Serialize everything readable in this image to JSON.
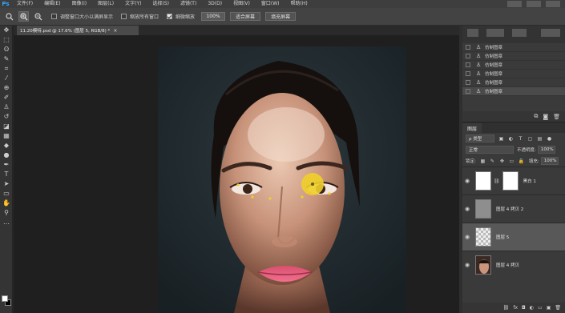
{
  "app": {
    "logo": "Ps"
  },
  "menu": [
    "文件(F)",
    "编辑(E)",
    "图像(I)",
    "图层(L)",
    "文字(Y)",
    "选择(S)",
    "滤镜(T)",
    "3D(D)",
    "视图(V)",
    "窗口(W)",
    "帮助(H)"
  ],
  "options": {
    "resize_windows_label": "调整窗口大小以满屏显示",
    "zoom_all_label": "缩放所有窗口",
    "scrubby_zoom_label": "细微缩放",
    "zoom_value": "100%",
    "fit_screen_label": "适合屏幕",
    "fill_screen_label": "填充屏幕",
    "resize_checked": false,
    "zoom_all_checked": false,
    "scrubby_checked": true
  },
  "document": {
    "tab_label": "11.20模特.psd @ 17.6% (图层 5, RGB/8) *",
    "close": "×"
  },
  "actions": {
    "items": [
      "仿制图章",
      "仿制图章",
      "仿制图章",
      "仿制图章",
      "仿制图章",
      "仿制图章"
    ]
  },
  "layers": {
    "tab": "图层",
    "filter_label": "ρ 类型",
    "blend_mode": "正常",
    "opacity_label": "不透明度:",
    "opacity": "100%",
    "lock_label": "锁定:",
    "fill_label": "填充:",
    "fill": "100%",
    "rows": [
      {
        "name": "黑白 1",
        "type": "adjustment",
        "visible": true,
        "selected": false
      },
      {
        "name": "图层 4 拷贝 2",
        "type": "gray",
        "visible": true,
        "selected": false
      },
      {
        "name": "图层 5",
        "type": "transparent",
        "visible": true,
        "selected": true
      },
      {
        "name": "图层 4 拷贝",
        "type": "photo",
        "visible": true,
        "selected": false
      }
    ],
    "footer_icons": [
      "link-icon",
      "fx-icon",
      "mask-icon",
      "adjustment-icon",
      "folder-icon",
      "new-layer-icon",
      "trash-icon"
    ]
  },
  "colors": {
    "foreground": "#ffffff",
    "background": "#000000",
    "brush_cursor": "#f0cf2a",
    "accent": "#31a8ff"
  }
}
